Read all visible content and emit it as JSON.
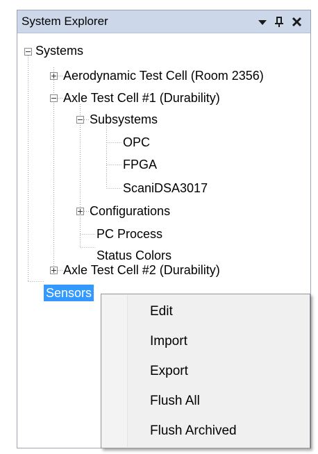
{
  "panel": {
    "title": "System Explorer",
    "buttons": {
      "dropdown_icon": "triangle-down",
      "pin_icon": "pin",
      "close_icon": "close-x"
    }
  },
  "tree": {
    "systems": "Systems",
    "aerodynamic": "Aerodynamic Test Cell (Room 2356)",
    "axle1": "Axle Test Cell #1 (Durability)",
    "subsystems": "Subsystems",
    "opc": "OPC",
    "fpga": "FPGA",
    "scani": "ScaniDSA3017",
    "configurations": "Configurations",
    "pc_process": "PC Process",
    "status_colors": "Status Colors",
    "axle2": "Axle Test Cell #2 (Durability)",
    "sensors": "Sensors"
  },
  "context_menu": {
    "items": [
      "Edit",
      "Import",
      "Export",
      "Flush All",
      "Flush Archived"
    ]
  },
  "colors": {
    "titlebar": "#ccd8ea",
    "selection": "#3399ff",
    "menu_bg": "#f0f0f0"
  }
}
